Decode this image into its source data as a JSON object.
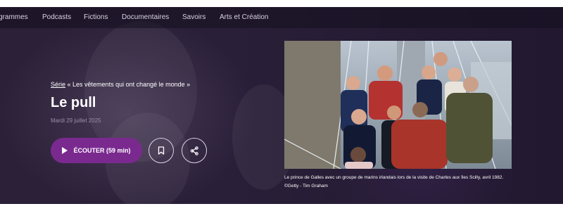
{
  "nav": {
    "items": [
      "grammes",
      "Podcasts",
      "Fictions",
      "Documentaires",
      "Savoirs",
      "Arts et Création"
    ]
  },
  "episode": {
    "series_label": "Série",
    "series_name": "« Les vêtements qui ont changé le monde »",
    "title": "Le pull",
    "date": "Mardi 29 juillet 2025"
  },
  "actions": {
    "listen_label": "ÉCOUTER (59 min)",
    "bookmark_icon": "bookmark-icon",
    "share_icon": "share-icon"
  },
  "image": {
    "caption": "Le prince de Galles avec un groupe de marins irlandais lors de la visite de Charles aux îles Scilly, avril 1982.",
    "credit": "©Getty - Tim Graham"
  },
  "colors": {
    "background": "#2a1f38",
    "accent": "#7a2a8f",
    "text": "#ffffff",
    "muted": "#9a8fa8"
  }
}
